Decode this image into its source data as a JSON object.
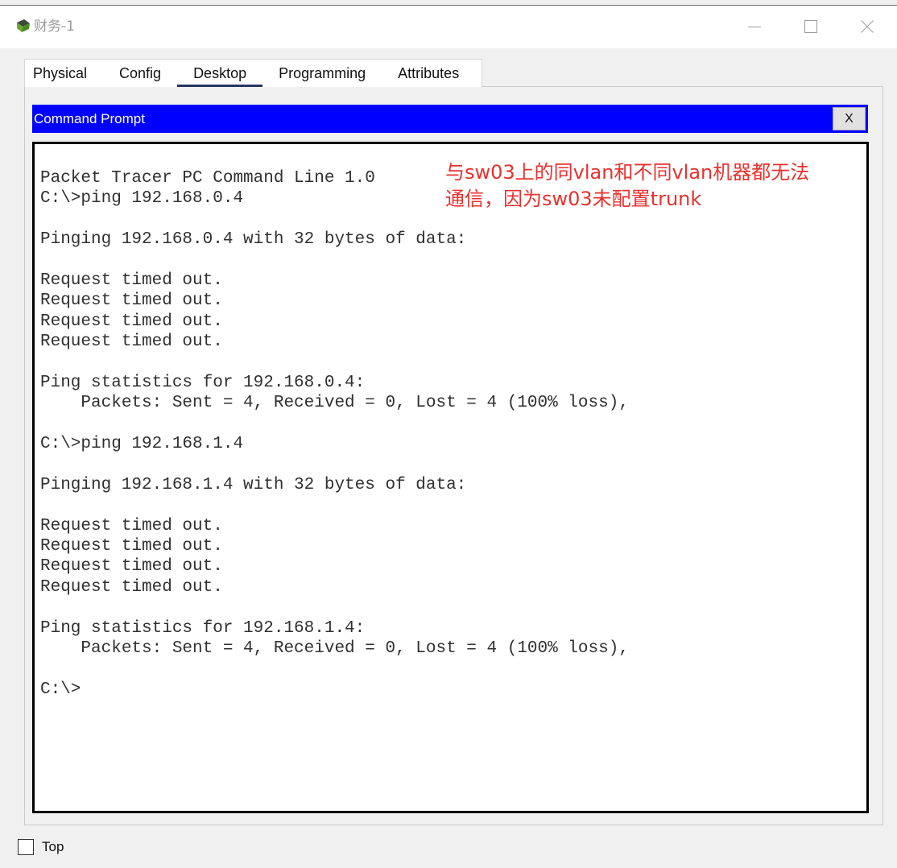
{
  "window": {
    "title": "财务-1",
    "icon": "packet-tracer-pc-icon",
    "controls": {
      "minimize": "minimize-icon",
      "maximize": "maximize-icon",
      "close": "close-icon"
    }
  },
  "tabs": [
    {
      "label": "Physical",
      "selected": false
    },
    {
      "label": "Config",
      "selected": false
    },
    {
      "label": "Desktop",
      "selected": true
    },
    {
      "label": "Programming",
      "selected": false
    },
    {
      "label": "Attributes",
      "selected": false
    }
  ],
  "command_prompt": {
    "title": "Command Prompt",
    "close_label": "X",
    "header_color": "#0000ff",
    "lines": [
      "Packet Tracer PC Command Line 1.0",
      "C:\\>ping 192.168.0.4",
      "",
      "Pinging 192.168.0.4 with 32 bytes of data:",
      "",
      "Request timed out.",
      "Request timed out.",
      "Request timed out.",
      "Request timed out.",
      "",
      "Ping statistics for 192.168.0.4:",
      "    Packets: Sent = 4, Received = 0, Lost = 4 (100% loss),",
      "",
      "C:\\>ping 192.168.1.4",
      "",
      "Pinging 192.168.1.4 with 32 bytes of data:",
      "",
      "Request timed out.",
      "Request timed out.",
      "Request timed out.",
      "Request timed out.",
      "",
      "Ping statistics for 192.168.1.4:",
      "    Packets: Sent = 4, Received = 0, Lost = 4 (100% loss),",
      "",
      "C:\\>"
    ]
  },
  "annotation": {
    "lines": [
      "与sw03上的同vlan和不同vlan机器都无法",
      "通信，因为sw03未配置trunk"
    ],
    "color": "#e8312e"
  },
  "footer": {
    "top_checkbox": {
      "label": "Top",
      "checked": false
    }
  }
}
